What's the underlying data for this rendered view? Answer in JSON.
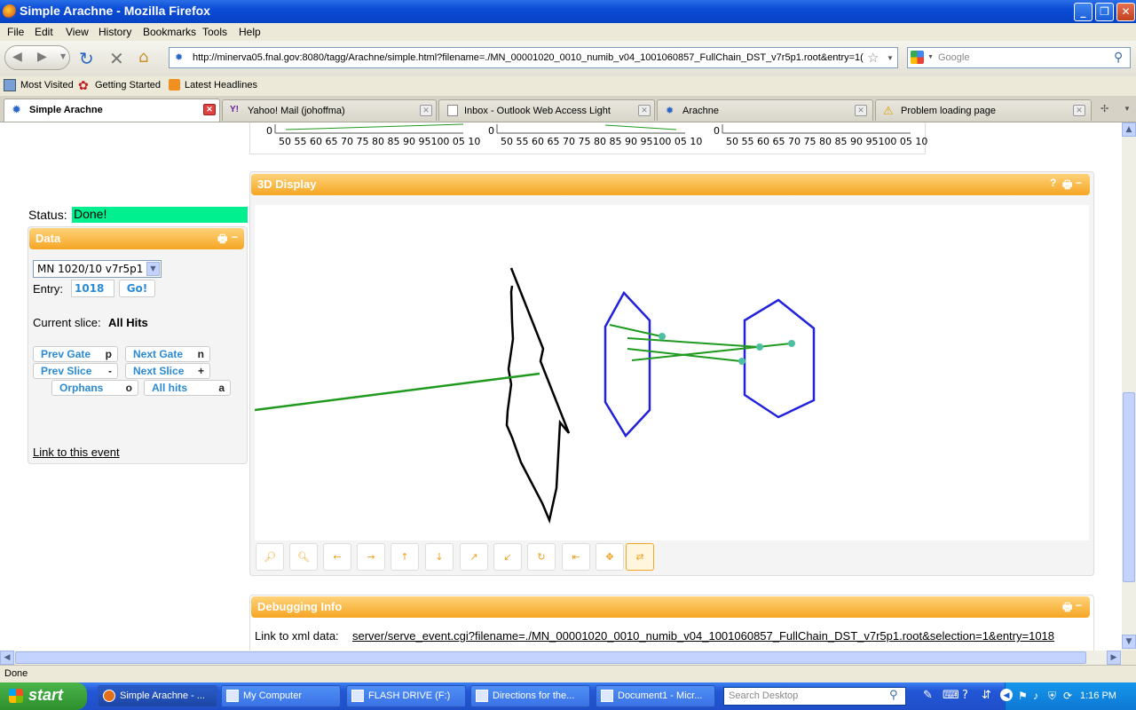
{
  "window": {
    "title": "Simple Arachne - Mozilla Firefox",
    "minimize": "_",
    "maximize": "❐",
    "close": "✕"
  },
  "menu": [
    "File",
    "Edit",
    "View",
    "History",
    "Bookmarks",
    "Tools",
    "Help"
  ],
  "nav": {
    "url": "http://minerva05.fnal.gov:8080/tagg/Arachne/simple.html?filename=./MN_00001020_0010_numib_v04_1001060857_FullChain_DST_v7r5p1.root&entry=1(",
    "search_placeholder": "Google"
  },
  "bookmarks": [
    "Most Visited",
    "Getting Started",
    "Latest Headlines"
  ],
  "tabs": [
    {
      "label": "Simple Arachne",
      "active": true
    },
    {
      "label": "Yahoo! Mail (johoffma)",
      "active": false
    },
    {
      "label": "Inbox - Outlook Web Access Light",
      "active": false
    },
    {
      "label": "Arachne",
      "active": false
    },
    {
      "label": "Problem loading page",
      "active": false
    }
  ],
  "histograms": {
    "zero": "0",
    "axis_ticks": "50 55 60 65 70 75 80 85 90 95100 05 10"
  },
  "status": {
    "label": "Status:",
    "value": "Done!",
    "color": "#00f090"
  },
  "data_panel": {
    "title": "Data",
    "selected_file": "MN 1020/10 v7r5p1",
    "entry_label": "Entry:",
    "entry_value": "1018",
    "go_label": "Go!",
    "current_slice_label": "Current slice:",
    "current_slice_value": "All Hits",
    "buttons": [
      {
        "label": "Prev Gate",
        "key": "p"
      },
      {
        "label": "Next Gate",
        "key": "n"
      },
      {
        "label": "Prev Slice",
        "key": "-"
      },
      {
        "label": "Next Slice",
        "key": "+"
      },
      {
        "label": "Orphans",
        "key": "o"
      },
      {
        "label": "All hits",
        "key": "a"
      }
    ],
    "link_text": "Link to this event"
  },
  "display_panel": {
    "title": "3D Display",
    "help": "?",
    "print": "🖶",
    "collapse": "−",
    "tools": [
      "zoom-in",
      "zoom-out",
      "pan-left",
      "pan-right",
      "pan-up",
      "pan-down",
      "rotate-up",
      "rotate-down",
      "reset",
      "home",
      "move",
      "swap"
    ]
  },
  "debug_panel": {
    "title": "Debugging Info",
    "link_label": "Link to xml data:",
    "link_url": "server/serve_event.cgi?filename=./MN_00001020_0010_numib_v04_1001060857_FullChain_DST_v7r5p1.root&selection=1&entry=1018"
  },
  "statusbar": {
    "text": "Done"
  },
  "taskbar": {
    "start": "start",
    "items": [
      {
        "label": "Simple Arachne - ...",
        "active": true
      },
      {
        "label": "My Computer",
        "active": false
      },
      {
        "label": "FLASH DRIVE (F:)",
        "active": false
      },
      {
        "label": "Directions for the...",
        "active": false
      },
      {
        "label": "Document1 - Micr...",
        "active": false
      }
    ],
    "search_placeholder": "Search Desktop",
    "clock": "1:16 PM"
  },
  "colors": {
    "panel_header": "#f5a623",
    "track": "#1f9a1f",
    "detector_outline": "#2222dd",
    "link_blue": "#2a8ad4"
  }
}
